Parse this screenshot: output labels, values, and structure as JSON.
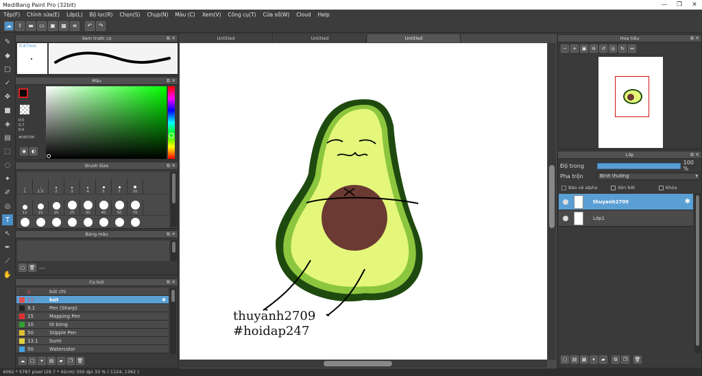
{
  "app": {
    "title": "MediBang Paint Pro (32bit)",
    "window_controls": [
      "—",
      "❐",
      "✕"
    ]
  },
  "menu": [
    "Tệp(F)",
    "Chỉnh sửa(E)",
    "Lớp(L)",
    "Bộ lọc(R)",
    "Chọn(S)",
    "Chụp(N)",
    "Màu (C)",
    "Xem(V)",
    "Công cụ(T)",
    "Cửa sổ(W)",
    "Cloud",
    "Help"
  ],
  "toolbar": {
    "undo": "↶",
    "redo": "↷"
  },
  "brush_preview": {
    "title": "Xem trước cọ",
    "size_label": "0.87mm"
  },
  "color": {
    "title": "Màu",
    "r": "R:6",
    "g": "G:7",
    "b": "B:6",
    "hex": "#060706",
    "fg": "#060706",
    "accent": "#4a90c8"
  },
  "brush_size": {
    "title": "Brush Size",
    "row1": [
      "1",
      "1.5",
      "2",
      "3",
      "4",
      "5",
      "7",
      "10"
    ],
    "row2": [
      "12",
      "15",
      "20",
      "25",
      "30",
      "40",
      "50",
      "70"
    ]
  },
  "palette": {
    "title": "Bảng màu",
    "dash": "---"
  },
  "brushes": {
    "title": "Cọ bút",
    "items": [
      {
        "size": "4",
        "name": "bút chì",
        "color": "#444444"
      },
      {
        "size": "12",
        "name": "bút",
        "color": "#e05050"
      },
      {
        "size": "9.1",
        "name": "Pen (Sharp)",
        "color": "#222222"
      },
      {
        "size": "15",
        "name": "Mapping Pen",
        "color": "#e03030"
      },
      {
        "size": "10",
        "name": "tô bóng",
        "color": "#30a030"
      },
      {
        "size": "50",
        "name": "Stipple Pen",
        "color": "#e0c030"
      },
      {
        "size": "13.1",
        "name": "Sumi",
        "color": "#e0d040"
      },
      {
        "size": "50",
        "name": "Watercolor",
        "color": "#40a0e0"
      }
    ]
  },
  "tabs": [
    "Untitled",
    "Untitled",
    "Untitled"
  ],
  "canvas": {
    "text1": "thuyanh2709",
    "text2": "#hoidap247"
  },
  "navigator": {
    "title": "Hoa tiêu"
  },
  "layers": {
    "title": "Lớp",
    "opacity_label": "Độ trong",
    "opacity_value": "100 %",
    "blend_label": "Pha trộn",
    "blend_value": "Bình thường",
    "protect_alpha": "Bảo vệ alpha",
    "clip": "Xén bớt",
    "lock": "Khóa",
    "items": [
      {
        "name": "thuyanh2709"
      },
      {
        "name": "Lớp1"
      }
    ]
  },
  "status": {
    "text": "4092 * 5787 pixel  (29.7 * 42cm)  350 dpi  33 %  ( 1124, 1362 )"
  }
}
